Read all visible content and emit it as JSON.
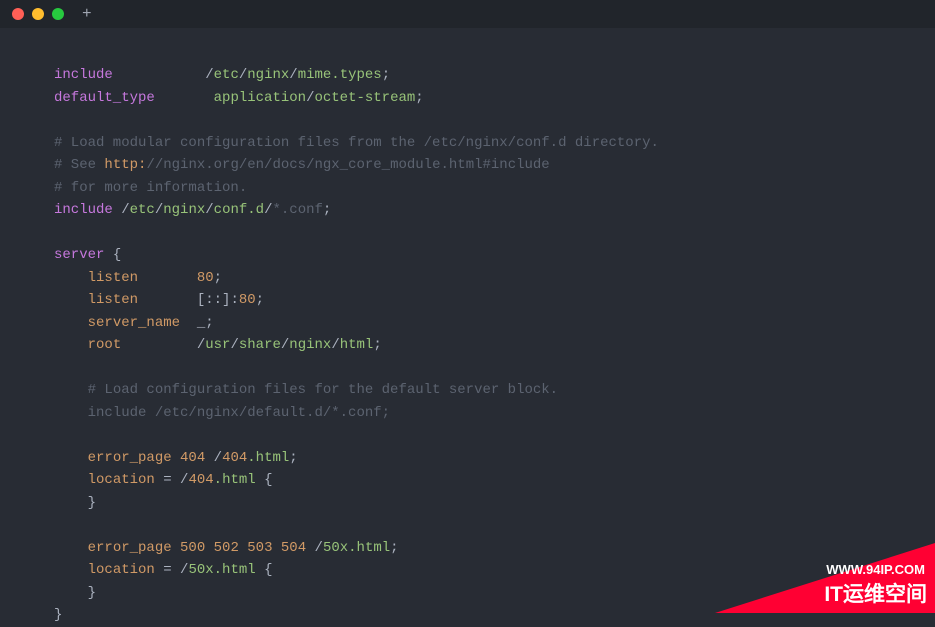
{
  "watermark": {
    "url": "WWW.94IP.COM",
    "text": "IT运维空间"
  },
  "code": {
    "tokens": [
      [
        {
          "t": "include",
          "c": "kw"
        },
        {
          "t": "           ",
          "c": "punct"
        },
        {
          "t": "/",
          "c": "slash"
        },
        {
          "t": "etc",
          "c": "path"
        },
        {
          "t": "/",
          "c": "slash"
        },
        {
          "t": "nginx",
          "c": "path"
        },
        {
          "t": "/",
          "c": "slash"
        },
        {
          "t": "mime.types",
          "c": "path"
        },
        {
          "t": ";",
          "c": "punct"
        }
      ],
      [
        {
          "t": "default_type",
          "c": "kw"
        },
        {
          "t": "       ",
          "c": "punct"
        },
        {
          "t": "application",
          "c": "path"
        },
        {
          "t": "/",
          "c": "slash"
        },
        {
          "t": "octet-stream",
          "c": "path"
        },
        {
          "t": ";",
          "c": "punct"
        }
      ],
      [],
      [
        {
          "t": "# Load modular configuration files from the /etc/nginx/conf.d directory.",
          "c": "comment"
        }
      ],
      [
        {
          "t": "# See ",
          "c": "comment"
        },
        {
          "t": "http:",
          "c": "url-scheme"
        },
        {
          "t": "//nginx.org/en/docs/ngx_core_module.html#include",
          "c": "url-rest"
        }
      ],
      [
        {
          "t": "# for more information.",
          "c": "comment"
        }
      ],
      [
        {
          "t": "include",
          "c": "kw"
        },
        {
          "t": " ",
          "c": "punct"
        },
        {
          "t": "/",
          "c": "slash"
        },
        {
          "t": "etc",
          "c": "path"
        },
        {
          "t": "/",
          "c": "slash"
        },
        {
          "t": "nginx",
          "c": "path"
        },
        {
          "t": "/",
          "c": "slash"
        },
        {
          "t": "conf.d",
          "c": "path"
        },
        {
          "t": "/",
          "c": "slash"
        },
        {
          "t": "*.conf",
          "c": "comment"
        },
        {
          "t": ";",
          "c": "punct"
        }
      ],
      [],
      [
        {
          "t": "server ",
          "c": "kw"
        },
        {
          "t": "{",
          "c": "punct"
        }
      ],
      [
        {
          "t": "    ",
          "c": "punct"
        },
        {
          "t": "listen",
          "c": "kw-orange"
        },
        {
          "t": "       ",
          "c": "punct"
        },
        {
          "t": "80",
          "c": "num"
        },
        {
          "t": ";",
          "c": "punct"
        }
      ],
      [
        {
          "t": "    ",
          "c": "punct"
        },
        {
          "t": "listen",
          "c": "kw-orange"
        },
        {
          "t": "       [::]:",
          "c": "punct"
        },
        {
          "t": "80",
          "c": "num"
        },
        {
          "t": ";",
          "c": "punct"
        }
      ],
      [
        {
          "t": "    ",
          "c": "punct"
        },
        {
          "t": "server_name",
          "c": "kw-orange"
        },
        {
          "t": "  _;",
          "c": "punct"
        }
      ],
      [
        {
          "t": "    ",
          "c": "punct"
        },
        {
          "t": "root",
          "c": "kw-orange"
        },
        {
          "t": "         ",
          "c": "punct"
        },
        {
          "t": "/",
          "c": "slash"
        },
        {
          "t": "usr",
          "c": "path"
        },
        {
          "t": "/",
          "c": "slash"
        },
        {
          "t": "share",
          "c": "path"
        },
        {
          "t": "/",
          "c": "slash"
        },
        {
          "t": "nginx",
          "c": "path"
        },
        {
          "t": "/",
          "c": "slash"
        },
        {
          "t": "html",
          "c": "path"
        },
        {
          "t": ";",
          "c": "punct"
        }
      ],
      [],
      [
        {
          "t": "    ",
          "c": "punct"
        },
        {
          "t": "# Load configuration files for the default server block.",
          "c": "comment"
        }
      ],
      [
        {
          "t": "    ",
          "c": "punct"
        },
        {
          "t": "include /etc/nginx/default.d/*.conf;",
          "c": "comment"
        }
      ],
      [],
      [
        {
          "t": "    ",
          "c": "punct"
        },
        {
          "t": "error_page",
          "c": "kw-orange"
        },
        {
          "t": " ",
          "c": "punct"
        },
        {
          "t": "404",
          "c": "num"
        },
        {
          "t": " ",
          "c": "punct"
        },
        {
          "t": "/",
          "c": "slash"
        },
        {
          "t": "404",
          "c": "num"
        },
        {
          "t": ".html",
          "c": "path"
        },
        {
          "t": ";",
          "c": "punct"
        }
      ],
      [
        {
          "t": "    ",
          "c": "punct"
        },
        {
          "t": "location",
          "c": "kw-orange"
        },
        {
          "t": " = ",
          "c": "punct"
        },
        {
          "t": "/",
          "c": "slash"
        },
        {
          "t": "404",
          "c": "num"
        },
        {
          "t": ".html",
          "c": "path"
        },
        {
          "t": " {",
          "c": "punct"
        }
      ],
      [
        {
          "t": "    }",
          "c": "punct"
        }
      ],
      [],
      [
        {
          "t": "    ",
          "c": "punct"
        },
        {
          "t": "error_page",
          "c": "kw-orange"
        },
        {
          "t": " ",
          "c": "punct"
        },
        {
          "t": "500",
          "c": "num"
        },
        {
          "t": " ",
          "c": "punct"
        },
        {
          "t": "502",
          "c": "num"
        },
        {
          "t": " ",
          "c": "punct"
        },
        {
          "t": "503",
          "c": "num"
        },
        {
          "t": " ",
          "c": "punct"
        },
        {
          "t": "504",
          "c": "num"
        },
        {
          "t": " ",
          "c": "punct"
        },
        {
          "t": "/",
          "c": "slash"
        },
        {
          "t": "50x.html",
          "c": "path"
        },
        {
          "t": ";",
          "c": "punct"
        }
      ],
      [
        {
          "t": "    ",
          "c": "punct"
        },
        {
          "t": "location",
          "c": "kw-orange"
        },
        {
          "t": " = ",
          "c": "punct"
        },
        {
          "t": "/",
          "c": "slash"
        },
        {
          "t": "50x.html",
          "c": "path"
        },
        {
          "t": " {",
          "c": "punct"
        }
      ],
      [
        {
          "t": "    }",
          "c": "punct"
        }
      ],
      [
        {
          "t": "}",
          "c": "punct"
        }
      ]
    ]
  }
}
